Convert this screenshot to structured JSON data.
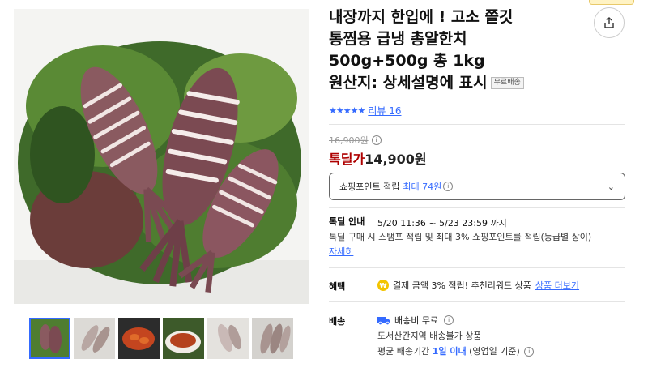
{
  "product": {
    "title_lines": [
      "내장까지 한입에 ! 고소 쫄깃",
      "통찜용 급냉 총알한치",
      "500g+500g 총 1kg",
      "원산지: 상세설명에 표시"
    ],
    "free_shipping_badge": "무료배송",
    "rating_stars": "★★★★★",
    "review_link": "리뷰 16",
    "original_price": "16,900원",
    "deal_label": "톡딜가",
    "deal_price": "14,900원"
  },
  "points": {
    "label": "쇼핑포인트 적립",
    "highlight": "최대 74원",
    "chevron": "⌄"
  },
  "talkdeal": {
    "label": "톡딜 안내",
    "time_range": "5/20 11:36 ~ 5/23 23:59 까지",
    "description": "톡딜 구매 시 스탬프 적립 및 최대 3% 쇼핑포인트를 적립(등급별 상이)",
    "detail_link": "자세히"
  },
  "benefit": {
    "label": "혜택",
    "icon_text": "₩",
    "text": "결제 금액 3% 적립! 추천리워드 상품",
    "more_link": "상품 더보기"
  },
  "shipping": {
    "label": "배송",
    "fee": "배송비 무료",
    "restriction": "도서산간지역 배송불가 상품",
    "avg_prefix": "평균 배송기간",
    "avg_days": "1일 이내",
    "avg_suffix": "(영업일 기준)"
  },
  "colors": {
    "accent": "#346aff",
    "deal_red": "#ae0000",
    "coin_yellow": "#f3c400"
  }
}
